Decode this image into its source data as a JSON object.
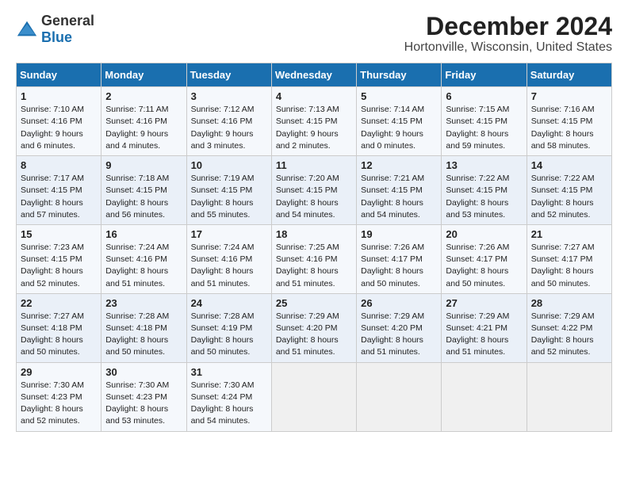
{
  "logo": {
    "general": "General",
    "blue": "Blue"
  },
  "title": "December 2024",
  "subtitle": "Hortonville, Wisconsin, United States",
  "days_of_week": [
    "Sunday",
    "Monday",
    "Tuesday",
    "Wednesday",
    "Thursday",
    "Friday",
    "Saturday"
  ],
  "weeks": [
    [
      {
        "day": "1",
        "sunrise": "7:10 AM",
        "sunset": "4:16 PM",
        "daylight": "9 hours and 6 minutes."
      },
      {
        "day": "2",
        "sunrise": "7:11 AM",
        "sunset": "4:16 PM",
        "daylight": "9 hours and 4 minutes."
      },
      {
        "day": "3",
        "sunrise": "7:12 AM",
        "sunset": "4:16 PM",
        "daylight": "9 hours and 3 minutes."
      },
      {
        "day": "4",
        "sunrise": "7:13 AM",
        "sunset": "4:15 PM",
        "daylight": "9 hours and 2 minutes."
      },
      {
        "day": "5",
        "sunrise": "7:14 AM",
        "sunset": "4:15 PM",
        "daylight": "9 hours and 0 minutes."
      },
      {
        "day": "6",
        "sunrise": "7:15 AM",
        "sunset": "4:15 PM",
        "daylight": "8 hours and 59 minutes."
      },
      {
        "day": "7",
        "sunrise": "7:16 AM",
        "sunset": "4:15 PM",
        "daylight": "8 hours and 58 minutes."
      }
    ],
    [
      {
        "day": "8",
        "sunrise": "7:17 AM",
        "sunset": "4:15 PM",
        "daylight": "8 hours and 57 minutes."
      },
      {
        "day": "9",
        "sunrise": "7:18 AM",
        "sunset": "4:15 PM",
        "daylight": "8 hours and 56 minutes."
      },
      {
        "day": "10",
        "sunrise": "7:19 AM",
        "sunset": "4:15 PM",
        "daylight": "8 hours and 55 minutes."
      },
      {
        "day": "11",
        "sunrise": "7:20 AM",
        "sunset": "4:15 PM",
        "daylight": "8 hours and 54 minutes."
      },
      {
        "day": "12",
        "sunrise": "7:21 AM",
        "sunset": "4:15 PM",
        "daylight": "8 hours and 54 minutes."
      },
      {
        "day": "13",
        "sunrise": "7:22 AM",
        "sunset": "4:15 PM",
        "daylight": "8 hours and 53 minutes."
      },
      {
        "day": "14",
        "sunrise": "7:22 AM",
        "sunset": "4:15 PM",
        "daylight": "8 hours and 52 minutes."
      }
    ],
    [
      {
        "day": "15",
        "sunrise": "7:23 AM",
        "sunset": "4:15 PM",
        "daylight": "8 hours and 52 minutes."
      },
      {
        "day": "16",
        "sunrise": "7:24 AM",
        "sunset": "4:16 PM",
        "daylight": "8 hours and 51 minutes."
      },
      {
        "day": "17",
        "sunrise": "7:24 AM",
        "sunset": "4:16 PM",
        "daylight": "8 hours and 51 minutes."
      },
      {
        "day": "18",
        "sunrise": "7:25 AM",
        "sunset": "4:16 PM",
        "daylight": "8 hours and 51 minutes."
      },
      {
        "day": "19",
        "sunrise": "7:26 AM",
        "sunset": "4:17 PM",
        "daylight": "8 hours and 50 minutes."
      },
      {
        "day": "20",
        "sunrise": "7:26 AM",
        "sunset": "4:17 PM",
        "daylight": "8 hours and 50 minutes."
      },
      {
        "day": "21",
        "sunrise": "7:27 AM",
        "sunset": "4:17 PM",
        "daylight": "8 hours and 50 minutes."
      }
    ],
    [
      {
        "day": "22",
        "sunrise": "7:27 AM",
        "sunset": "4:18 PM",
        "daylight": "8 hours and 50 minutes."
      },
      {
        "day": "23",
        "sunrise": "7:28 AM",
        "sunset": "4:18 PM",
        "daylight": "8 hours and 50 minutes."
      },
      {
        "day": "24",
        "sunrise": "7:28 AM",
        "sunset": "4:19 PM",
        "daylight": "8 hours and 50 minutes."
      },
      {
        "day": "25",
        "sunrise": "7:29 AM",
        "sunset": "4:20 PM",
        "daylight": "8 hours and 51 minutes."
      },
      {
        "day": "26",
        "sunrise": "7:29 AM",
        "sunset": "4:20 PM",
        "daylight": "8 hours and 51 minutes."
      },
      {
        "day": "27",
        "sunrise": "7:29 AM",
        "sunset": "4:21 PM",
        "daylight": "8 hours and 51 minutes."
      },
      {
        "day": "28",
        "sunrise": "7:29 AM",
        "sunset": "4:22 PM",
        "daylight": "8 hours and 52 minutes."
      }
    ],
    [
      {
        "day": "29",
        "sunrise": "7:30 AM",
        "sunset": "4:23 PM",
        "daylight": "8 hours and 52 minutes."
      },
      {
        "day": "30",
        "sunrise": "7:30 AM",
        "sunset": "4:23 PM",
        "daylight": "8 hours and 53 minutes."
      },
      {
        "day": "31",
        "sunrise": "7:30 AM",
        "sunset": "4:24 PM",
        "daylight": "8 hours and 54 minutes."
      },
      null,
      null,
      null,
      null
    ]
  ],
  "labels": {
    "sunrise": "Sunrise:",
    "sunset": "Sunset:",
    "daylight": "Daylight:"
  }
}
